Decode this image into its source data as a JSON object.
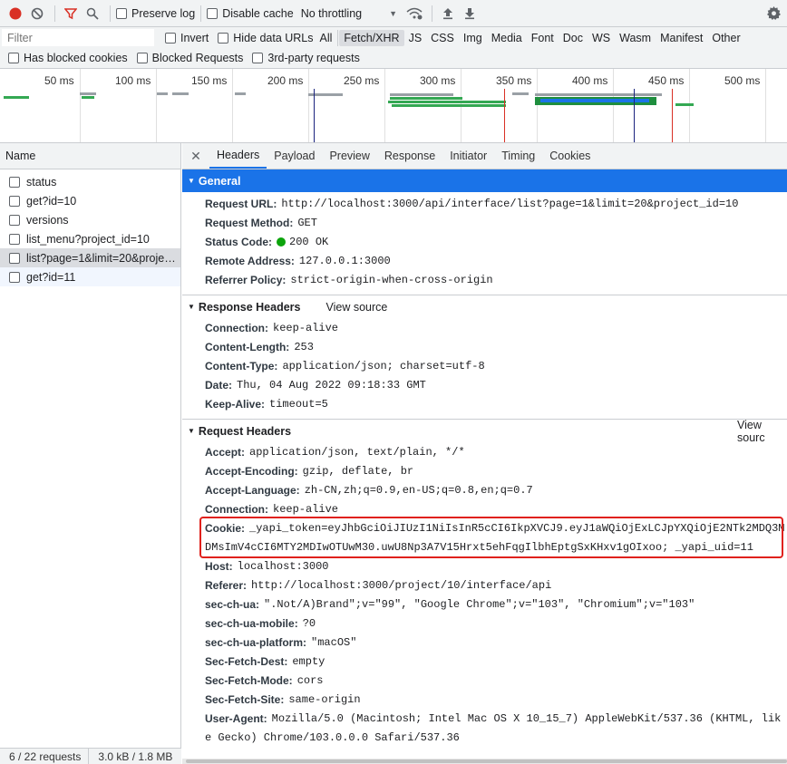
{
  "toolbar": {
    "preserve_log": "Preserve log",
    "disable_cache": "Disable cache",
    "throttling": "No throttling"
  },
  "filter": {
    "placeholder": "Filter",
    "invert": "Invert",
    "hide_data_urls": "Hide data URLs",
    "types": [
      "All",
      "Fetch/XHR",
      "JS",
      "CSS",
      "Img",
      "Media",
      "Font",
      "Doc",
      "WS",
      "Wasm",
      "Manifest",
      "Other"
    ],
    "active_type": "Fetch/XHR",
    "has_blocked_cookies": "Has blocked cookies",
    "blocked_requests": "Blocked Requests",
    "third_party": "3rd-party requests"
  },
  "overview": {
    "ticks": [
      "50 ms",
      "100 ms",
      "150 ms",
      "200 ms",
      "250 ms",
      "300 ms",
      "350 ms",
      "400 ms",
      "450 ms",
      "500 ms"
    ]
  },
  "requests": {
    "header": "Name",
    "items": [
      {
        "name": "status"
      },
      {
        "name": "get?id=10"
      },
      {
        "name": "versions"
      },
      {
        "name": "list_menu?project_id=10"
      },
      {
        "name": "list?page=1&limit=20&projec..."
      },
      {
        "name": "get?id=11"
      }
    ],
    "selected_index": 4,
    "summary_count": "6 / 22 requests",
    "summary_size": "3.0 kB / 1.8 MB"
  },
  "detail_tabs": [
    "Headers",
    "Payload",
    "Preview",
    "Response",
    "Initiator",
    "Timing",
    "Cookies"
  ],
  "active_tab": "Headers",
  "general": {
    "title": "General",
    "rows": [
      {
        "key": "Request URL:",
        "value": "http://localhost:3000/api/interface/list?page=1&limit=20&project_id=10"
      },
      {
        "key": "Request Method:",
        "value": "GET"
      },
      {
        "key": "Status Code:",
        "value": "200 OK"
      },
      {
        "key": "Remote Address:",
        "value": "127.0.0.1:3000"
      },
      {
        "key": "Referrer Policy:",
        "value": "strict-origin-when-cross-origin"
      }
    ]
  },
  "response_headers": {
    "title": "Response Headers",
    "view_source": "View source",
    "rows": [
      {
        "key": "Connection:",
        "value": "keep-alive"
      },
      {
        "key": "Content-Length:",
        "value": "253"
      },
      {
        "key": "Content-Type:",
        "value": "application/json; charset=utf-8"
      },
      {
        "key": "Date:",
        "value": "Thu, 04 Aug 2022 09:18:33 GMT"
      },
      {
        "key": "Keep-Alive:",
        "value": "timeout=5"
      }
    ]
  },
  "request_headers": {
    "title": "Request Headers",
    "view_source": "View sourc",
    "rows": [
      {
        "key": "Accept:",
        "value": "application/json, text/plain, */*"
      },
      {
        "key": "Accept-Encoding:",
        "value": "gzip, deflate, br"
      },
      {
        "key": "Accept-Language:",
        "value": "zh-CN,zh;q=0.9,en-US;q=0.8,en;q=0.7"
      },
      {
        "key": "Connection:",
        "value": "keep-alive"
      },
      {
        "key": "Cookie:",
        "value": "_yapi_token=eyJhbGciOiJIUzI1NiIsInR5cCI6IkpXVCJ9.eyJ1aWQiOjExLCJpYXQiOjE2NTk2MDQ3M"
      },
      {
        "key": "",
        "value": "DMsImV4cCI6MTY2MDIwOTUwM30.uwU8Np3A7V15Hrxt5ehFqgIlbhEptgSxKHxv1gOIxoo; _yapi_uid=11"
      },
      {
        "key": "Host:",
        "value": "localhost:3000"
      },
      {
        "key": "Referer:",
        "value": "http://localhost:3000/project/10/interface/api"
      },
      {
        "key": "sec-ch-ua:",
        "value": "\".Not/A)Brand\";v=\"99\", \"Google Chrome\";v=\"103\", \"Chromium\";v=\"103\""
      },
      {
        "key": "sec-ch-ua-mobile:",
        "value": "?0"
      },
      {
        "key": "sec-ch-ua-platform:",
        "value": "\"macOS\""
      },
      {
        "key": "Sec-Fetch-Dest:",
        "value": "empty"
      },
      {
        "key": "Sec-Fetch-Mode:",
        "value": "cors"
      },
      {
        "key": "Sec-Fetch-Site:",
        "value": "same-origin"
      },
      {
        "key": "User-Agent:",
        "value": "Mozilla/5.0 (Macintosh; Intel Mac OS X 10_15_7) AppleWebKit/537.36 (KHTML, lik"
      },
      {
        "key": "",
        "value": "e Gecko) Chrome/103.0.0.0 Safari/537.36"
      }
    ]
  },
  "colors": {
    "accent": "#1a73e8",
    "record": "#d93025",
    "highlight_box": "#e0211c",
    "status_ok": "#0ca40c"
  }
}
